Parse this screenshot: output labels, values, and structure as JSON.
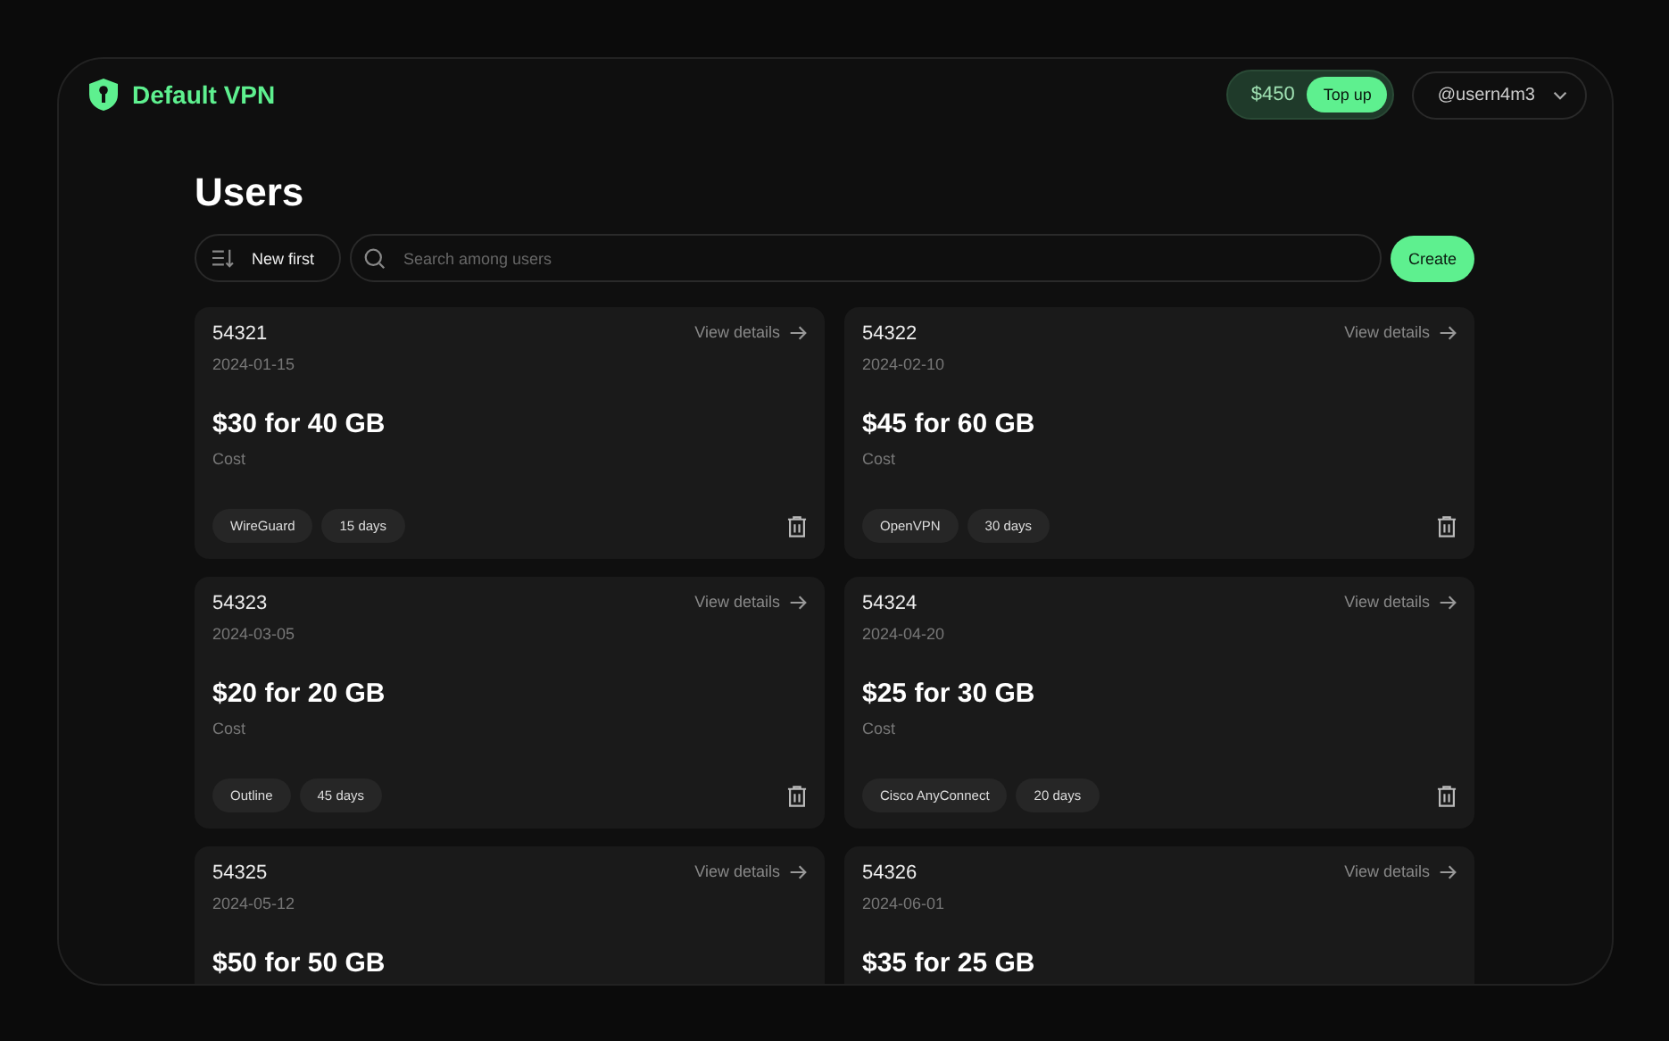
{
  "brand": {
    "name": "Default VPN"
  },
  "balance": {
    "amount": "$450",
    "action": "Top up"
  },
  "account": {
    "username": "@usern4m3"
  },
  "page": {
    "title": "Users"
  },
  "toolbar": {
    "sort": "New first",
    "search_placeholder": "Search among users",
    "create": "Create"
  },
  "users": [
    {
      "id": "54321",
      "date": "2024-01-15",
      "link": "View details",
      "price": "$30 for 40 GB",
      "price_label": "Cost",
      "tags": [
        "WireGuard",
        "15 days"
      ]
    },
    {
      "id": "54322",
      "date": "2024-02-10",
      "link": "View details",
      "price": "$45 for 60 GB",
      "price_label": "Cost",
      "tags": [
        "OpenVPN",
        "30 days"
      ]
    },
    {
      "id": "54323",
      "date": "2024-03-05",
      "link": "View details",
      "price": "$20 for 20 GB",
      "price_label": "Cost",
      "tags": [
        "Outline",
        "45 days"
      ]
    },
    {
      "id": "54324",
      "date": "2024-04-20",
      "link": "View details",
      "price": "$25 for 30 GB",
      "price_label": "Cost",
      "tags": [
        "Cisco AnyConnect",
        "20 days"
      ]
    },
    {
      "id": "54325",
      "date": "2024-05-12",
      "link": "View details",
      "price": "$50 for 50 GB"
    },
    {
      "id": "54326",
      "date": "2024-06-01",
      "link": "View details",
      "price": "$35 for 25 GB"
    }
  ]
}
